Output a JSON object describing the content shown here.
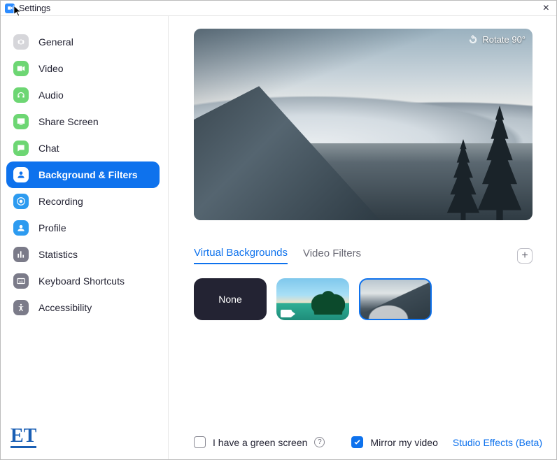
{
  "window": {
    "title": "Settings"
  },
  "sidebar": {
    "items": [
      {
        "label": "General"
      },
      {
        "label": "Video"
      },
      {
        "label": "Audio"
      },
      {
        "label": "Share Screen"
      },
      {
        "label": "Chat"
      },
      {
        "label": "Background & Filters"
      },
      {
        "label": "Recording"
      },
      {
        "label": "Profile"
      },
      {
        "label": "Statistics"
      },
      {
        "label": "Keyboard Shortcuts"
      },
      {
        "label": "Accessibility"
      }
    ],
    "active_index": 5
  },
  "preview": {
    "rotate_label": "Rotate 90°"
  },
  "tabs": {
    "items": [
      {
        "label": "Virtual Backgrounds"
      },
      {
        "label": "Video Filters"
      }
    ],
    "active_index": 0
  },
  "thumbnails": {
    "none_label": "None",
    "selected_index": 2
  },
  "footer": {
    "green_screen_label": "I have a green screen",
    "green_screen_checked": false,
    "mirror_label": "Mirror my video",
    "mirror_checked": true,
    "studio_link": "Studio Effects (Beta)"
  },
  "branding": {
    "logo_text": "ET"
  },
  "colors": {
    "accent": "#0E72ED",
    "nav_green": "#6dd673",
    "nav_blue": "#2D9BF0",
    "nav_gray": "#7b7b89"
  }
}
